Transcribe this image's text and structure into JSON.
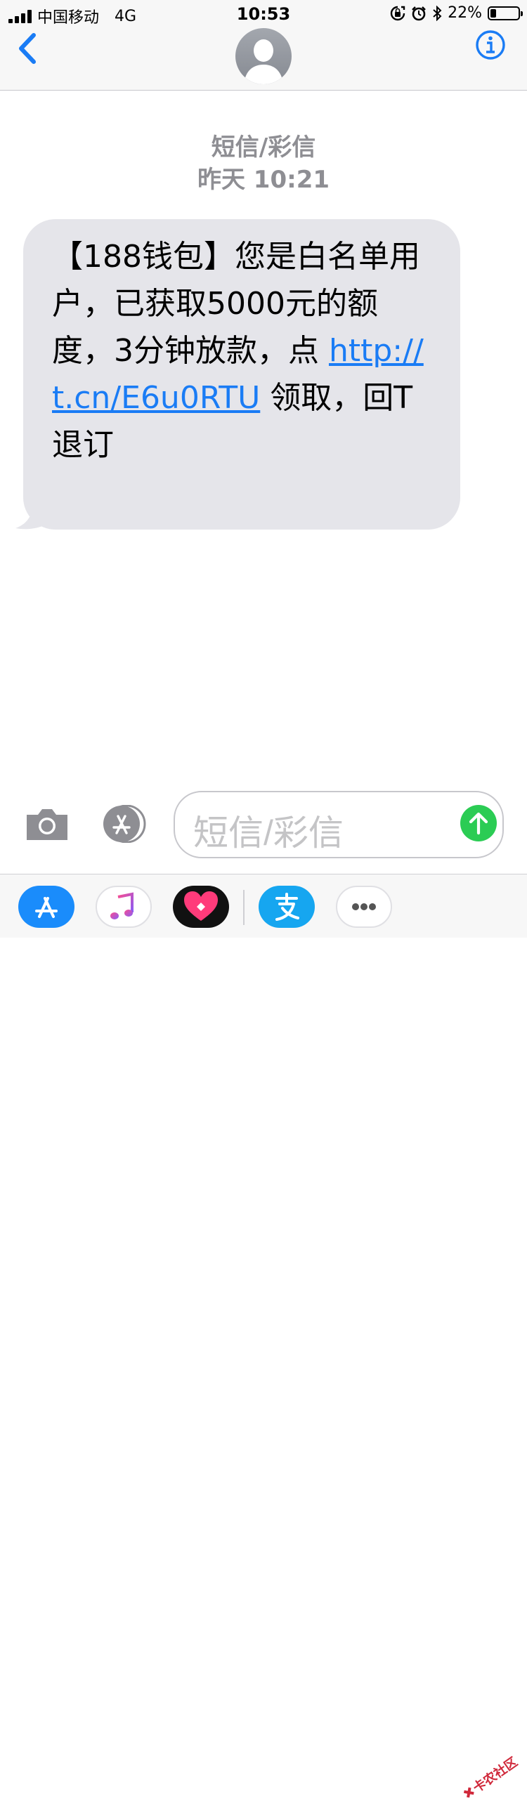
{
  "status_bar": {
    "carrier": "中国移动",
    "network": "4G",
    "time": "10:53",
    "battery_percent": "22%",
    "battery_level": 0.22
  },
  "header": {
    "back_icon": "chevron-left-icon",
    "avatar_icon": "person-silhouette-icon",
    "info_icon": "info-icon",
    "accent_color": "#1a7cf5"
  },
  "conversation": {
    "service_label": "短信/彩信",
    "timestamp": "昨天 10:21",
    "message": {
      "text_before_link": "【188钱包】您是白名单用户，已获取5000元的额度，3分钟放款，点 ",
      "link": "http://t.cn/E6u0RTU",
      "text_after_link": " 领取，回T退订"
    }
  },
  "input_bar": {
    "placeholder": "短信/彩信",
    "camera_icon": "camera-icon",
    "apps_icon": "app-store-icon",
    "send_icon": "send-arrow-up-icon",
    "send_color": "#2bcc54"
  },
  "app_drawer": {
    "apps": [
      {
        "name": "app-store-icon",
        "color": "#1a8cfb"
      },
      {
        "name": "music-icon",
        "color": "#ffffff"
      },
      {
        "name": "heart-app-icon",
        "color": "#111111"
      },
      {
        "name": "alipay-icon",
        "color": "#16a6f0"
      },
      {
        "name": "more-icon",
        "color": "#ffffff"
      }
    ],
    "watermark": "卡农社区"
  }
}
